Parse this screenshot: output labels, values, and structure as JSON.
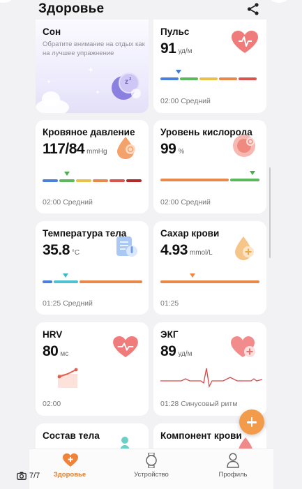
{
  "header": {
    "title": "Здоровье"
  },
  "cards": {
    "sleep": {
      "title": "Сон",
      "desc": "Обратите внимание на отдых как на лучшее упражнение"
    },
    "pulse": {
      "title": "Пульс",
      "value": "91",
      "unit": "уд/м",
      "footer": "02:00 Средний"
    },
    "bp": {
      "title": "Кровяное давление",
      "value": "117/84",
      "unit": "mmHg",
      "footer": "02:00 Средний"
    },
    "oxygen": {
      "title": "Уровень кислорода",
      "value": "99",
      "unit": "%",
      "footer": "02:00 Средний"
    },
    "temp": {
      "title": "Температура тела",
      "value": "35.8",
      "unit": "°C",
      "footer": "01:25 Средний"
    },
    "sugar": {
      "title": "Сахар крови",
      "value": "4.93",
      "unit": "mmol/L",
      "footer": "01:25"
    },
    "hrv": {
      "title": "HRV",
      "value": "80",
      "unit": "мс",
      "footer": "02:00"
    },
    "ecg": {
      "title": "ЭКГ",
      "value": "89",
      "unit": "уд/м",
      "footer": "01:28 Синусовый ритм"
    },
    "body": {
      "title": "Состав тела"
    },
    "blood": {
      "title": "Компонент крови"
    }
  },
  "nav": {
    "health": "Здоровье",
    "device": "Устройство",
    "profile": "Профиль"
  },
  "gallery": {
    "counter": "7/7"
  },
  "colors": {
    "accent": "#f29b4b",
    "active": "#e57c2c",
    "green": "#5cb85c",
    "red": "#e04848"
  }
}
